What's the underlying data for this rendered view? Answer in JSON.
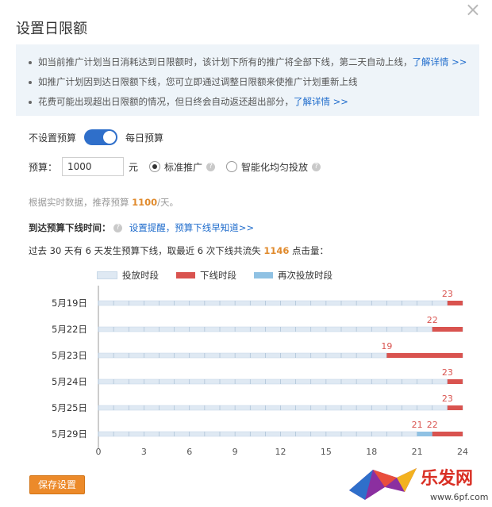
{
  "dialog": {
    "title": "设置日限额",
    "close": "×"
  },
  "notice": [
    {
      "text": "如当前推广计划当日消耗达到日限额时，该计划下所有的推广将全部下线，第二天自动上线，",
      "link": "了解详情 >>"
    },
    {
      "text": "如推广计划因到达日限额下线，您可立即通过调整日限额来使推广计划重新上线",
      "link": ""
    },
    {
      "text": "花费可能出现超出日限额的情况，但日终会自动返还超出部分，",
      "link": "了解详情 >>"
    }
  ],
  "budget_toggle": {
    "left_label": "不设置预算",
    "right_label": "每日预算",
    "on": true
  },
  "amount": {
    "label": "预算：",
    "value": "1000",
    "unit": "元",
    "options": [
      {
        "label": "标准推广",
        "selected": true
      },
      {
        "label": "智能化均匀投放",
        "selected": false
      }
    ]
  },
  "suggest": {
    "prefix": "根据实时数据，推荐预算 ",
    "value": "1100",
    "suffix": "/天。"
  },
  "reach": {
    "label": "到达预算下线时间：",
    "link": "设置提醒，预算下线早知道>>"
  },
  "past": {
    "prefix": "过去 30 天有 6 天发生预算下线，取最近 6 次下线共流失 ",
    "value": "1146",
    "suffix": " 点击量："
  },
  "legend": [
    {
      "label": "投放时段",
      "color": "#dfe9f3"
    },
    {
      "label": "下线时段",
      "color": "#d9534f"
    },
    {
      "label": "再次投放时段",
      "color": "#8fc1e3"
    }
  ],
  "chart_data": {
    "type": "bar",
    "orientation": "horizontal-timeline",
    "x_range": [
      0,
      24
    ],
    "x_ticks": [
      "0",
      "3",
      "6",
      "9",
      "12",
      "15",
      "18",
      "21",
      "24"
    ],
    "categories": [
      "5月19日",
      "5月22日",
      "5月23日",
      "5月24日",
      "5月25日",
      "5月29日"
    ],
    "rows": [
      {
        "date": "5月19日",
        "offline_start": 23,
        "relaunch": null,
        "offline_end": 24,
        "labels": [
          "23"
        ]
      },
      {
        "date": "5月22日",
        "offline_start": 22,
        "relaunch": null,
        "offline_end": 24,
        "labels": [
          "22"
        ]
      },
      {
        "date": "5月23日",
        "offline_start": 19,
        "relaunch": null,
        "offline_end": 24,
        "labels": [
          "19"
        ]
      },
      {
        "date": "5月24日",
        "offline_start": 23,
        "relaunch": null,
        "offline_end": 24,
        "labels": [
          "23"
        ]
      },
      {
        "date": "5月25日",
        "offline_start": 23,
        "relaunch": null,
        "offline_end": 24,
        "labels": [
          "23"
        ]
      },
      {
        "date": "5月29日",
        "offline_start": 21,
        "relaunch": 22,
        "offline_end": 24,
        "labels": [
          "21",
          "22"
        ]
      }
    ],
    "colors": {
      "active": "#dfe9f3",
      "offline": "#d9534f",
      "relaunch": "#8fc1e3"
    }
  },
  "save_button": "保存设置",
  "watermark": {
    "brand": "乐发网",
    "url": "www.6pf.com"
  }
}
